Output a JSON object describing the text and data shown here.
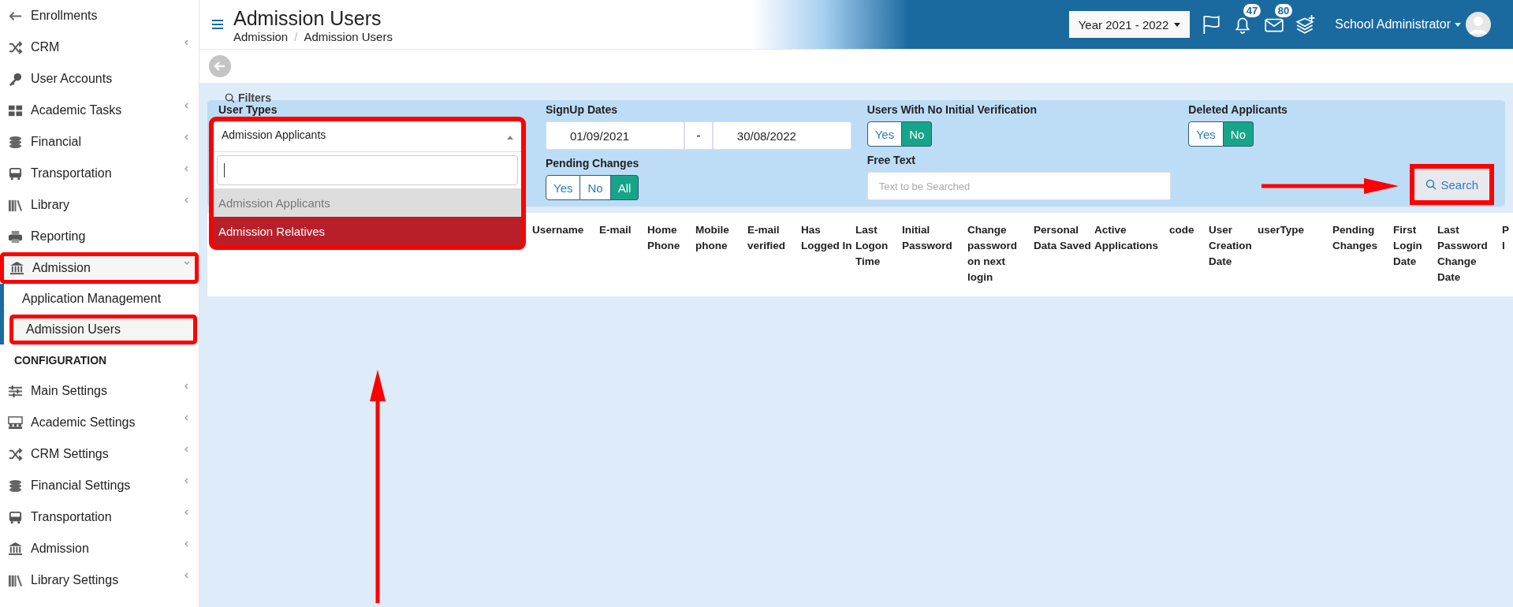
{
  "sidebar": {
    "items": [
      {
        "kind": "link",
        "label": "Enrollments"
      },
      {
        "kind": "link",
        "label": "CRM",
        "expanded": false
      },
      {
        "kind": "link",
        "label": "User Accounts"
      },
      {
        "kind": "link",
        "label": "Academic Tasks",
        "expanded": false
      },
      {
        "kind": "link",
        "label": "Financial",
        "expanded": false
      },
      {
        "kind": "link",
        "label": "Transportation",
        "expanded": false
      },
      {
        "kind": "link",
        "label": "Library",
        "expanded": false
      },
      {
        "kind": "link",
        "label": "Reporting"
      },
      {
        "kind": "link",
        "label": "Admission",
        "expanded": true,
        "highlighted": true,
        "children": [
          {
            "label": "Application Management",
            "selected": false,
            "highlighted": false
          },
          {
            "label": "Admission Users",
            "selected": true,
            "highlighted": true
          }
        ]
      },
      {
        "kind": "section",
        "label": "CONFIGURATION"
      },
      {
        "kind": "link",
        "label": "Main Settings",
        "expanded": false
      },
      {
        "kind": "link",
        "label": "Academic Settings",
        "expanded": false
      },
      {
        "kind": "link",
        "label": "CRM Settings",
        "expanded": false
      },
      {
        "kind": "link",
        "label": "Financial Settings",
        "expanded": false
      },
      {
        "kind": "link",
        "label": "Transportation",
        "expanded": false
      },
      {
        "kind": "link",
        "label": "Admission",
        "expanded": false
      },
      {
        "kind": "link",
        "label": "Library Settings",
        "expanded": false
      }
    ]
  },
  "header": {
    "title": "Admission Users",
    "breadcrumb": [
      "Admission",
      "Admission Users"
    ],
    "breadcrumb_separator": "/",
    "year_select": "Year 2021 - 2022",
    "notifications": "47",
    "messages": "80",
    "user": "School Administrator"
  },
  "filters": {
    "title": "Filters",
    "user_types": {
      "label": "User Types",
      "value": "Admission Applicants",
      "open": true,
      "highlighted": true,
      "pointer_arrow": true,
      "options": [
        {
          "label": "Admission Applicants",
          "selected": true,
          "hovered": false
        },
        {
          "label": "Admission Relatives",
          "selected": false,
          "hovered": true
        }
      ]
    },
    "signup_dates": {
      "label": "SignUp Dates",
      "from": "01/09/2021",
      "separator": "-",
      "to": "30/08/2022"
    },
    "no_initial_verification": {
      "label": "Users With No Initial Verification",
      "options": [
        {
          "label": "Yes",
          "selected": false
        },
        {
          "label": "No",
          "selected": true
        }
      ]
    },
    "deleted_applicants": {
      "label": "Deleted Applicants",
      "options": [
        {
          "label": "Yes",
          "selected": false
        },
        {
          "label": "No",
          "selected": true
        }
      ]
    },
    "pending_changes": {
      "label": "Pending Changes",
      "options": [
        {
          "label": "Yes",
          "selected": false
        },
        {
          "label": "No",
          "selected": false
        },
        {
          "label": "All",
          "selected": true
        }
      ]
    },
    "free_text": {
      "label": "Free Text",
      "placeholder": "Text to be Searched"
    },
    "search_button": {
      "label": "Search",
      "highlighted": true,
      "pointer_arrow": true
    }
  },
  "table": {
    "columns": [
      "Username",
      "E-mail",
      "Home Phone",
      "Mobile phone",
      "E-mail verified",
      "Has Logged In",
      "Last Logon Time",
      "Initial Password",
      "Change password on next login",
      "Personal Data Saved",
      "Active Applications",
      "code",
      "User Creation Date",
      "userType",
      "Pending Changes",
      "First Login Date",
      "Last Password Change Date",
      "P I"
    ]
  }
}
